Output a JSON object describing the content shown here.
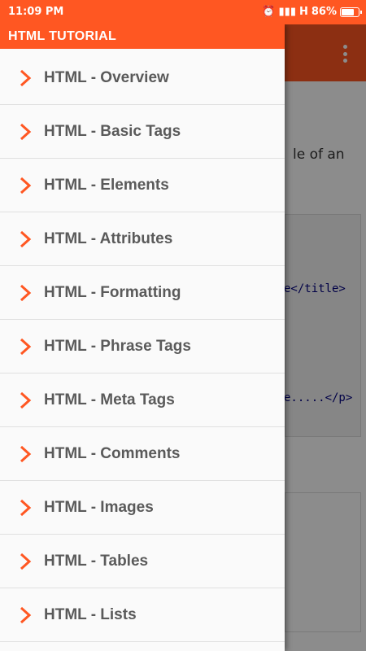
{
  "status": {
    "time": "11:09 PM",
    "network": "H",
    "battery": "86%",
    "battery_level": 0.86
  },
  "drawer": {
    "title": "HTML TUTORIAL",
    "items": [
      {
        "label": "HTML - Overview"
      },
      {
        "label": "HTML - Basic Tags"
      },
      {
        "label": "HTML - Elements"
      },
      {
        "label": "HTML - Attributes"
      },
      {
        "label": "HTML - Formatting"
      },
      {
        "label": "HTML - Phrase Tags"
      },
      {
        "label": "HTML - Meta Tags"
      },
      {
        "label": "HTML - Comments"
      },
      {
        "label": "HTML - Images"
      },
      {
        "label": "HTML - Tables"
      },
      {
        "label": "HTML - Lists"
      }
    ]
  },
  "background": {
    "text_fragment": "le of an",
    "code_line_1": "e</title>",
    "code_line_2": "e.....</p>"
  },
  "colors": {
    "accent": "#ff5722",
    "chevron": "#ff5722",
    "label": "#5a5a5a"
  }
}
